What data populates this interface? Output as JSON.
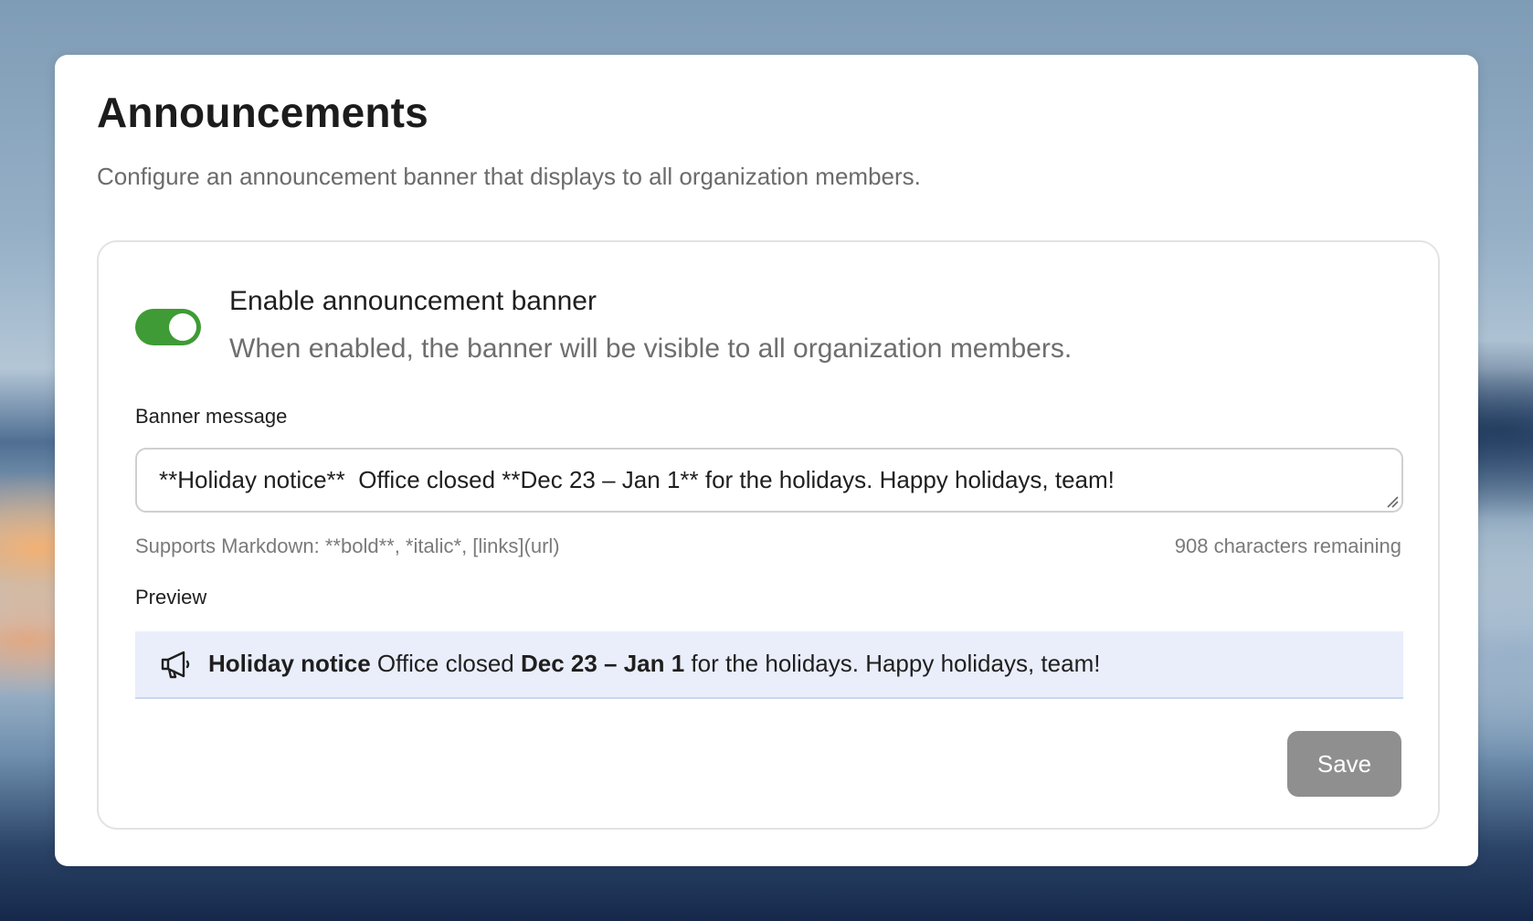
{
  "header": {
    "title": "Announcements",
    "subtitle": "Configure an announcement banner that displays to all organization members."
  },
  "toggle": {
    "title": "Enable announcement banner",
    "description": "When enabled, the banner will be visible to all organization members.",
    "enabled": true,
    "color": "#3e9b35"
  },
  "message": {
    "label": "Banner message",
    "value": "**Holiday notice**  Office closed **Dec 23 – Jan 1** for the holidays. Happy holidays, team!",
    "hint": "Supports Markdown: **bold**, *italic*, [links](url)",
    "remaining": "908 characters remaining"
  },
  "preview": {
    "label": "Preview",
    "icon": "megaphone-icon",
    "bold_1": "Holiday notice",
    "text_1": " Office closed ",
    "bold_2": "Dec 23 – Jan 1",
    "text_2": " for the holidays. Happy holidays, team!",
    "background": "#e9eefa"
  },
  "actions": {
    "save_label": "Save"
  }
}
